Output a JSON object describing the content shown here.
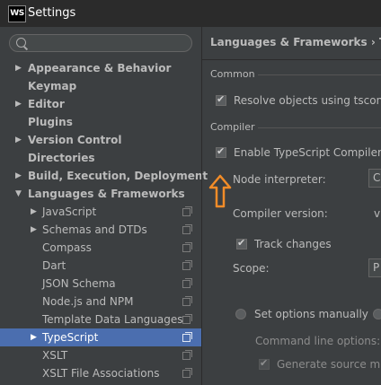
{
  "window": {
    "app_icon": "WS",
    "title": "Settings"
  },
  "search": {
    "placeholder": ""
  },
  "sidebar": {
    "items": [
      {
        "label": "Appearance & Behavior",
        "bold": true,
        "arrow": "right"
      },
      {
        "label": "Keymap",
        "bold": true,
        "arrow": ""
      },
      {
        "label": "Editor",
        "bold": true,
        "arrow": "right"
      },
      {
        "label": "Plugins",
        "bold": true,
        "arrow": ""
      },
      {
        "label": "Version Control",
        "bold": true,
        "arrow": "right"
      },
      {
        "label": "Directories",
        "bold": true,
        "arrow": ""
      },
      {
        "label": "Build, Execution, Deployment",
        "bold": true,
        "arrow": "right"
      },
      {
        "label": "Languages & Frameworks",
        "bold": true,
        "arrow": "down"
      },
      {
        "label": "JavaScript",
        "bold": false,
        "arrow": "right"
      },
      {
        "label": "Schemas and DTDs",
        "bold": false,
        "arrow": "right"
      },
      {
        "label": "Compass",
        "bold": false,
        "arrow": ""
      },
      {
        "label": "Dart",
        "bold": false,
        "arrow": ""
      },
      {
        "label": "JSON Schema",
        "bold": false,
        "arrow": ""
      },
      {
        "label": "Node.js and NPM",
        "bold": false,
        "arrow": ""
      },
      {
        "label": "Template Data Languages",
        "bold": false,
        "arrow": ""
      },
      {
        "label": "TypeScript",
        "bold": false,
        "arrow": "right",
        "selected": true
      },
      {
        "label": "XSLT",
        "bold": false,
        "arrow": ""
      },
      {
        "label": "XSLT File Associations",
        "bold": false,
        "arrow": ""
      }
    ]
  },
  "main": {
    "breadcrumb": "Languages & Frameworks › TypeScr",
    "common": {
      "section_label": "Common",
      "resolve_objects": "Resolve objects using tsconfig.js"
    },
    "compiler": {
      "section_label": "Compiler",
      "enable_compiler": "Enable TypeScript Compiler",
      "node_interpreter_label": "Node interpreter:",
      "node_interpreter_value": "C",
      "compiler_version_label": "Compiler version:",
      "compiler_version_value": "v",
      "track_changes": "Track changes",
      "scope_label": "Scope:",
      "scope_value": "P",
      "set_options_manually": "Set options manually",
      "command_line_options_label": "Command line options:",
      "generate_source_maps": "Generate source maps"
    }
  },
  "colors": {
    "selection": "#4b6eaf",
    "annotation_arrow": "#f28c28",
    "background": "#3c3f41"
  }
}
